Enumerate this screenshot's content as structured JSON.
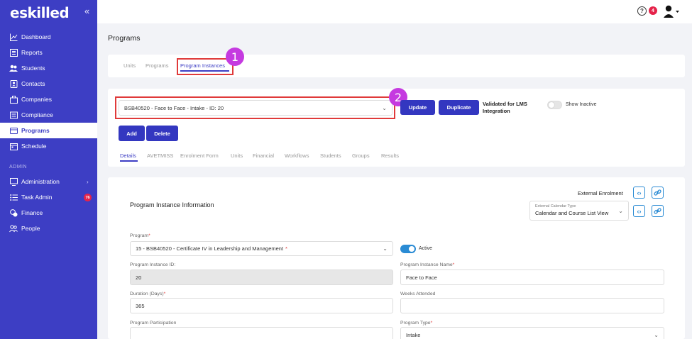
{
  "sidebar": {
    "logo": "eskilled",
    "collapse_icon": "«",
    "items": [
      {
        "label": "Dashboard",
        "icon": "chart-icon"
      },
      {
        "label": "Reports",
        "icon": "report-icon"
      },
      {
        "label": "Students",
        "icon": "students-icon"
      },
      {
        "label": "Contacts",
        "icon": "contacts-icon"
      },
      {
        "label": "Companies",
        "icon": "companies-icon"
      },
      {
        "label": "Compliance",
        "icon": "compliance-icon"
      },
      {
        "label": "Programs",
        "icon": "programs-icon"
      },
      {
        "label": "Schedule",
        "icon": "schedule-icon"
      }
    ],
    "admin_heading": "ADMIN",
    "admin_items": [
      {
        "label": "Administration",
        "icon": "monitor-icon"
      },
      {
        "label": "Task Admin",
        "icon": "list-icon",
        "badge": "76"
      },
      {
        "label": "Finance",
        "icon": "finance-icon"
      },
      {
        "label": "People",
        "icon": "people-icon"
      }
    ]
  },
  "topbar": {
    "help_badge": "4"
  },
  "page_title": "Programs",
  "top_tabs": [
    "Units",
    "Programs",
    "Program Instances"
  ],
  "instance_select": "BSB40520 - Face to Face - Intake - ID: 20",
  "buttons": {
    "update": "Update",
    "duplicate": "Duplicate",
    "add": "Add",
    "delete": "Delete"
  },
  "validated_text": "Validated for LMS Integration",
  "show_inactive": "Show Inactive",
  "detail_tabs": [
    "Details",
    "AVETMISS",
    "Enrolment Form",
    "Units",
    "Financial",
    "Workflows",
    "Students",
    "Groups",
    "Results"
  ],
  "callouts": [
    "1",
    "2"
  ],
  "info": {
    "heading": "Program Instance Information",
    "external_enrolment": "External Enrolment",
    "calendar_type_label": "External Calendar Type",
    "calendar_type_value": "Calendar and Course List View"
  },
  "form": {
    "program_label": "Program",
    "program_value": "15 - BSB40520 - Certificate IV in Leadership and Management",
    "active_label": "Active",
    "instance_id_label": "Program Instance ID:",
    "instance_id_value": "20",
    "instance_name_label": "Program Instance Name",
    "instance_name_value": "Face to Face",
    "duration_label": "Duration (Days)",
    "duration_value": "365",
    "weeks_label": "Weeks Attended",
    "weeks_value": "",
    "participation_label": "Program Participation",
    "participation_value": "",
    "type_label": "Program Type",
    "type_value": "Intake"
  },
  "colors": {
    "sidebar": "#3d3ec4",
    "button": "#3337c0",
    "highlight": "#e03a3a",
    "callout": "#c53ae0",
    "toggle": "#2a8bd4"
  }
}
